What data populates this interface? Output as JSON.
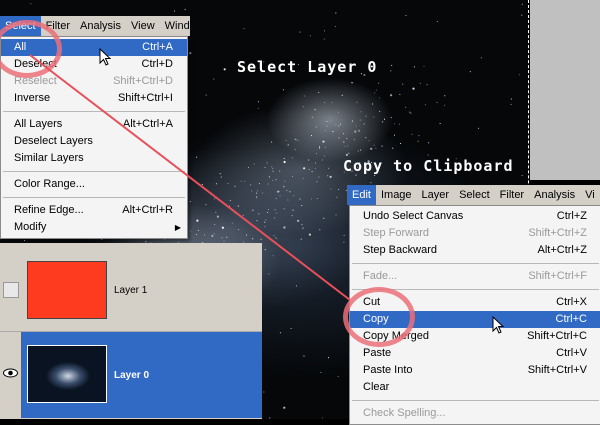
{
  "captions": {
    "select_layer": "Select Layer 0",
    "copy_clipboard": "Copy to Clipboard"
  },
  "select_menu": {
    "menubar": [
      "Select",
      "Filter",
      "Analysis",
      "View",
      "Wind"
    ],
    "items": [
      {
        "label": "All",
        "shortcut": "Ctrl+A",
        "state": "highlighted"
      },
      {
        "label": "Deselect",
        "shortcut": "Ctrl+D",
        "state": "normal"
      },
      {
        "label": "Reselect",
        "shortcut": "Shift+Ctrl+D",
        "state": "disabled"
      },
      {
        "label": "Inverse",
        "shortcut": "Shift+Ctrl+I",
        "state": "normal"
      },
      {
        "label": "All Layers",
        "shortcut": "Alt+Ctrl+A",
        "state": "normal"
      },
      {
        "label": "Deselect Layers",
        "shortcut": "",
        "state": "normal"
      },
      {
        "label": "Similar Layers",
        "shortcut": "",
        "state": "normal"
      },
      {
        "label": "Color Range...",
        "shortcut": "",
        "state": "normal"
      },
      {
        "label": "Refine Edge...",
        "shortcut": "Alt+Ctrl+R",
        "state": "normal"
      },
      {
        "label": "Modify",
        "shortcut": "",
        "state": "submenu"
      }
    ]
  },
  "edit_menu": {
    "menubar": [
      "Edit",
      "Image",
      "Layer",
      "Select",
      "Filter",
      "Analysis",
      "Vi"
    ],
    "items": [
      {
        "label": "Undo Select Canvas",
        "shortcut": "Ctrl+Z",
        "state": "normal"
      },
      {
        "label": "Step Forward",
        "shortcut": "Shift+Ctrl+Z",
        "state": "disabled"
      },
      {
        "label": "Step Backward",
        "shortcut": "Alt+Ctrl+Z",
        "state": "normal"
      },
      {
        "label": "Fade...",
        "shortcut": "Shift+Ctrl+F",
        "state": "disabled"
      },
      {
        "label": "Cut",
        "shortcut": "Ctrl+X",
        "state": "normal"
      },
      {
        "label": "Copy",
        "shortcut": "Ctrl+C",
        "state": "highlighted"
      },
      {
        "label": "Copy Merged",
        "shortcut": "Shift+Ctrl+C",
        "state": "normal"
      },
      {
        "label": "Paste",
        "shortcut": "Ctrl+V",
        "state": "normal"
      },
      {
        "label": "Paste Into",
        "shortcut": "Shift+Ctrl+V",
        "state": "normal"
      },
      {
        "label": "Clear",
        "shortcut": "",
        "state": "normal"
      },
      {
        "label": "Check Spelling...",
        "shortcut": "",
        "state": "disabled"
      }
    ]
  },
  "layers": [
    {
      "name": "Layer 1",
      "visible": false,
      "selected": false,
      "thumb_color": "#ff3b1f"
    },
    {
      "name": "Layer 0",
      "visible": true,
      "selected": true,
      "thumb_color": "#1a2a44"
    }
  ],
  "colors": {
    "highlight": "#316ac5",
    "annotation": "#e86a75",
    "menubar_bg": "#d4d0c8"
  }
}
